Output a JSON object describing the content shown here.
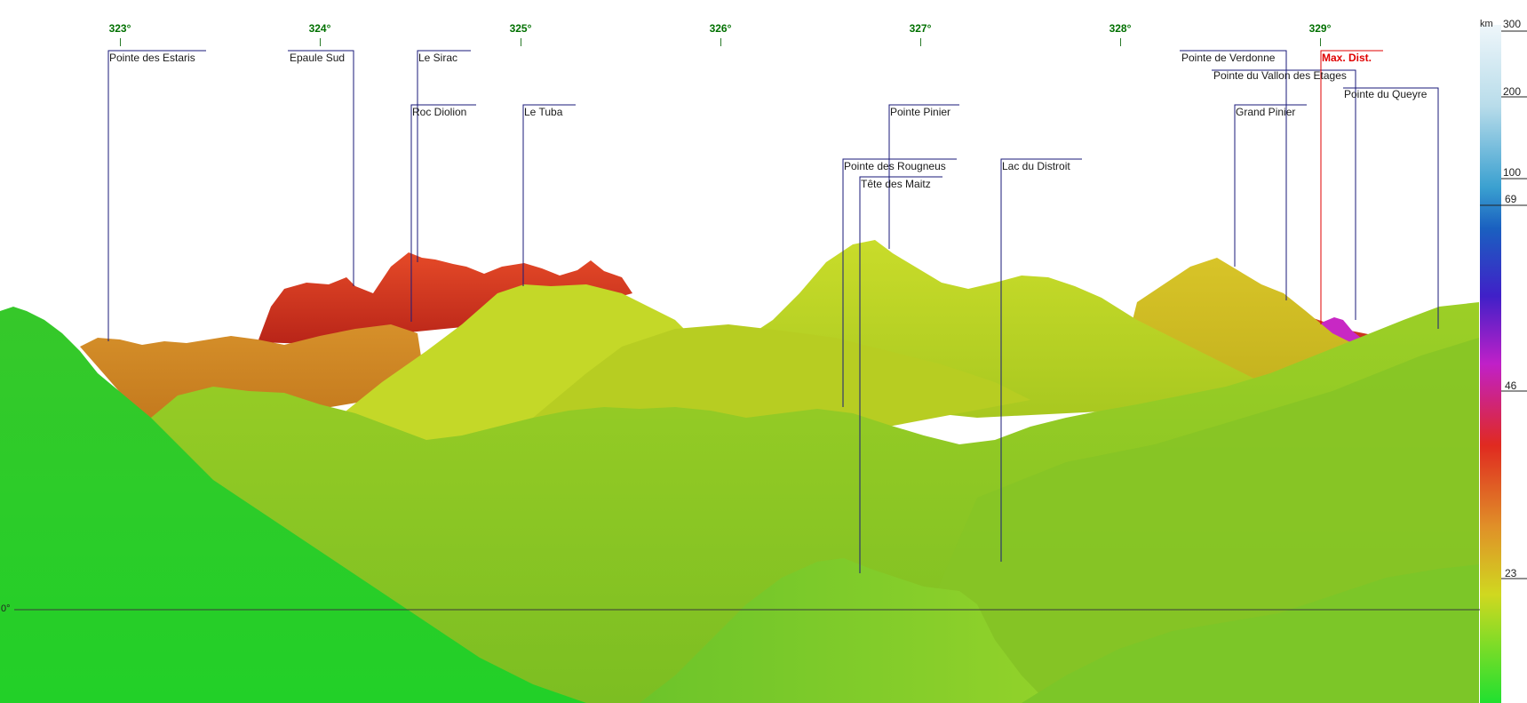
{
  "compass": {
    "ticks": [
      {
        "label": "323°",
        "deg": 323
      },
      {
        "label": "324°",
        "deg": 324
      },
      {
        "label": "325°",
        "deg": 325
      },
      {
        "label": "326°",
        "deg": 326
      },
      {
        "label": "327°",
        "deg": 327
      },
      {
        "label": "328°",
        "deg": 328
      },
      {
        "label": "329°",
        "deg": 329
      }
    ]
  },
  "horizon_label": "0°",
  "peaks": [
    {
      "name": "Pointe des Estaris"
    },
    {
      "name": "Epaule Sud"
    },
    {
      "name": "Le Sirac"
    },
    {
      "name": "Roc Diolion"
    },
    {
      "name": "Le Tuba"
    },
    {
      "name": "Pointe Pinier"
    },
    {
      "name": "Pointe des Rougneus"
    },
    {
      "name": "Tête des Maitz"
    },
    {
      "name": "Lac du Distroit"
    },
    {
      "name": "Pointe de Verdonne"
    },
    {
      "name": "Pointe du Vallon des Etages"
    },
    {
      "name": "Grand Pinier"
    },
    {
      "name": "Max. Dist."
    },
    {
      "name": "Pointe du Queyre"
    }
  ],
  "distance_scale": {
    "unit": "km",
    "ticks": [
      {
        "label": "300",
        "km": 300
      },
      {
        "label": "200",
        "km": 200
      },
      {
        "label": "100",
        "km": 100
      },
      {
        "label": "69",
        "km": 69
      },
      {
        "label": "46",
        "km": 46
      },
      {
        "label": "23",
        "km": 23
      }
    ],
    "marker_km": 69
  },
  "colors": {
    "near": "#22dd22",
    "mid": "#c8d820",
    "far": "#e0a020",
    "farther": "#dd2a1a",
    "farthest": "#cc22cc",
    "max_dist": "#e00000",
    "label_line": "#1a1a7a"
  }
}
